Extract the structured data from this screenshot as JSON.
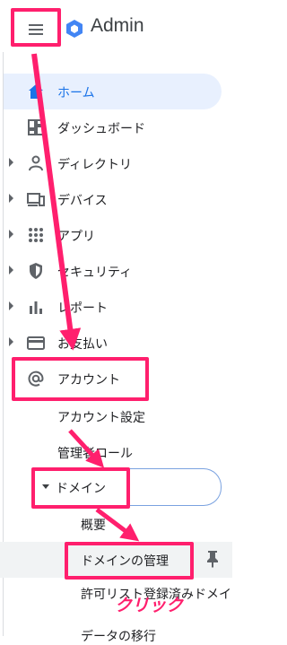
{
  "header": {
    "title": "Admin",
    "menu_icon": "hamburger-menu-icon",
    "logo_icon": "admin-hexagon-logo-icon"
  },
  "nav": {
    "items": [
      {
        "label": "ホーム",
        "icon": "home-icon",
        "active": true,
        "expandable": false
      },
      {
        "label": "ダッシュボード",
        "icon": "dashboard-icon",
        "active": false,
        "expandable": false
      },
      {
        "label": "ディレクトリ",
        "icon": "person-icon",
        "active": false,
        "expandable": true
      },
      {
        "label": "デバイス",
        "icon": "devices-icon",
        "active": false,
        "expandable": true
      },
      {
        "label": "アプリ",
        "icon": "apps-grid-icon",
        "active": false,
        "expandable": true
      },
      {
        "label": "セキュリティ",
        "icon": "shield-icon",
        "active": false,
        "expandable": true
      },
      {
        "label": "レポート",
        "icon": "bar-chart-icon",
        "active": false,
        "expandable": true
      },
      {
        "label": "お支払い",
        "icon": "credit-card-icon",
        "active": false,
        "expandable": true
      },
      {
        "label": "アカウント",
        "icon": "at-sign-icon",
        "active": false,
        "expandable": false
      }
    ],
    "account_children": [
      "アカウント設定",
      "管理者ロール"
    ],
    "domain_label": "ドメイン",
    "domain_children": [
      "概要",
      "ドメインの管理",
      "許可リスト登録済みドメイ",
      "データの移行"
    ]
  },
  "overlay": {
    "click_text": "クリック",
    "accent_color": "#ff1f6d"
  },
  "colors": {
    "active_bg": "#e8f0fe",
    "active_text": "#1a73e8",
    "logo_blue": "#4285f4"
  }
}
